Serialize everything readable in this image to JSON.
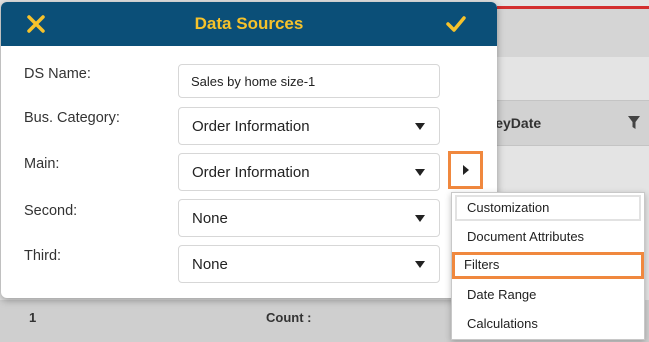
{
  "background": {
    "column_header": "rveyDate",
    "footer_row_number": "1",
    "footer_count_label": "Count :"
  },
  "dialog": {
    "title": "Data Sources",
    "close_icon": "close-x-icon",
    "confirm_icon": "checkmark-icon",
    "accent_color": "#f6c22b",
    "header_color": "#0b4f78",
    "fields": {
      "ds_name": {
        "label": "DS Name:",
        "value": "Sales by home size-1"
      },
      "bus_category": {
        "label": "Bus. Category:",
        "value": "Order Information"
      },
      "main": {
        "label": "Main:",
        "value": "Order Information"
      },
      "second": {
        "label": "Second:",
        "value": "None"
      },
      "third": {
        "label": "Third:",
        "value": "None"
      }
    }
  },
  "menu": {
    "items": [
      {
        "label": "Customization"
      },
      {
        "label": "Document Attributes"
      },
      {
        "label": "Filters"
      },
      {
        "label": "Date Range"
      },
      {
        "label": "Calculations"
      }
    ],
    "highlight_color": "#f0883e"
  }
}
